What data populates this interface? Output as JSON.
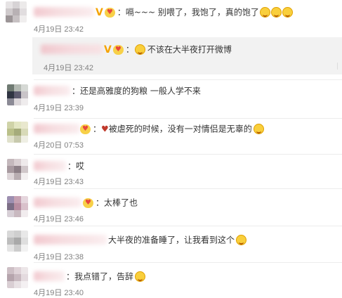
{
  "comments": [
    {
      "sep": "：",
      "text": "嗝~~~  别喂了，我饱了，真的饱了",
      "time": "4月19日 23:42"
    },
    {
      "sep": "：",
      "text": "不该在大半夜打开微博",
      "time": "4月19日 23:42"
    },
    {
      "sep": "：",
      "text": "还是高雅度的狗粮 一般人学不来",
      "time": "4月19日 23:39"
    },
    {
      "sep": "：",
      "text": "被虐死的时候，没有一对情侣是无辜的",
      "time": "4月20日 07:53"
    },
    {
      "sep": "：",
      "text": "哎",
      "time": "4月19日 23:43"
    },
    {
      "sep": "：",
      "text": "太棒了也",
      "time": "4月19日 23:46"
    },
    {
      "sep": "",
      "text": "大半夜的准备睡了，让我看到这个",
      "time": "4月19日 23:38"
    },
    {
      "sep": "：",
      "text": "我点错了，告辞",
      "time": "4月19日 23:40"
    }
  ],
  "icons": {
    "verified": "V",
    "member": "heart-icon",
    "emoji": "laughing-face-icon"
  }
}
